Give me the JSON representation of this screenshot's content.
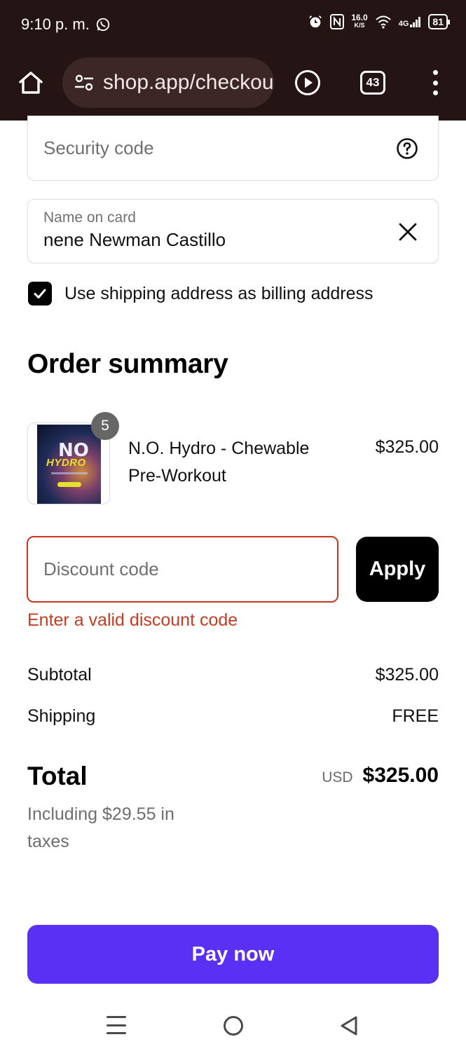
{
  "status_bar": {
    "time": "9:10 p. m.",
    "net_speed_value": "16.0",
    "net_speed_unit": "K/S",
    "network_type": "4G",
    "battery": "81"
  },
  "browser": {
    "url": "shop.app/checkout",
    "tab_count": "43"
  },
  "payment": {
    "security_code_placeholder": "Security code",
    "name_on_card_label": "Name on card",
    "name_on_card_value": "nene Newman Castillo",
    "billing_same_label": "Use shipping address as billing address",
    "billing_same_checked": true
  },
  "order_summary": {
    "title": "Order summary",
    "items": [
      {
        "quantity": "5",
        "name": "N.O. Hydro - Chewable Pre-Workout",
        "price": "$325.00",
        "image_text_1": "NO",
        "image_text_2": "HYDRO"
      }
    ],
    "discount_placeholder": "Discount code",
    "apply_label": "Apply",
    "discount_error": "Enter a valid discount code",
    "subtotal_label": "Subtotal",
    "subtotal_value": "$325.00",
    "shipping_label": "Shipping",
    "shipping_value": "FREE",
    "total_label": "Total",
    "total_currency": "USD",
    "total_value": "$325.00",
    "tax_note": "Including $29.55 in taxes"
  },
  "pay_button_label": "Pay now",
  "colors": {
    "chrome_bg": "#241414",
    "accent": "#5a31f4",
    "error": "#c43d22"
  }
}
